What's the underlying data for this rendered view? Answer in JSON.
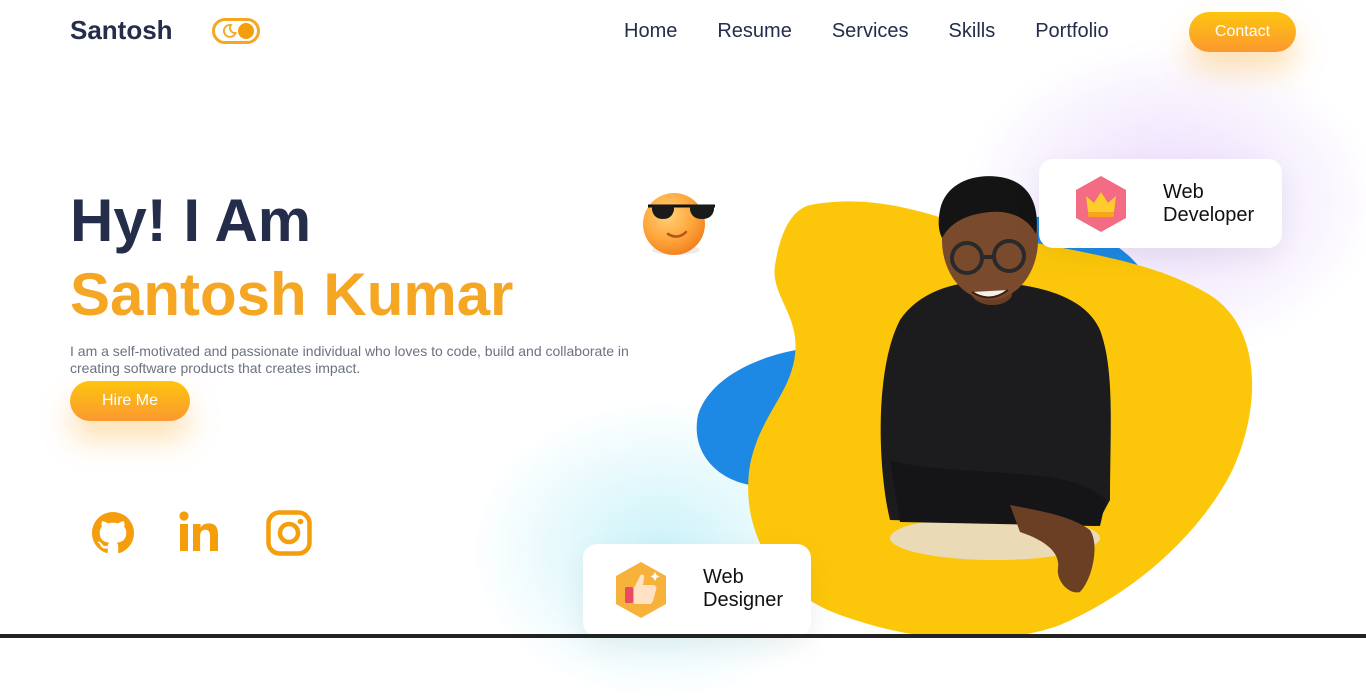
{
  "nav": {
    "brand": "Santosh",
    "links": [
      "Home",
      "Resume",
      "Services",
      "Skills",
      "Portfolio"
    ],
    "contact_label": "Contact",
    "theme_toggle_icon": "moon-icon"
  },
  "hero": {
    "greeting": "Hy! I Am",
    "name": "Santosh Kumar",
    "description": "I am a self-motivated and passionate individual who loves to code, build and collaborate in creating software products that creates impact.",
    "hire_label": "Hire Me"
  },
  "socials": [
    {
      "icon": "github-icon"
    },
    {
      "icon": "linkedin-icon"
    },
    {
      "icon": "instagram-icon"
    }
  ],
  "cards": {
    "web_developer": {
      "line1": "Web",
      "line2": "Developer",
      "icon": "crown-icon"
    },
    "web_designer": {
      "line1": "Web",
      "line2": "Designer",
      "icon": "thumbs-up-icon"
    }
  },
  "colors": {
    "accent": "#f5a623",
    "heading": "#242d49",
    "blob_yellow": "#fcc70a",
    "blob_blue": "#1e88e5"
  }
}
